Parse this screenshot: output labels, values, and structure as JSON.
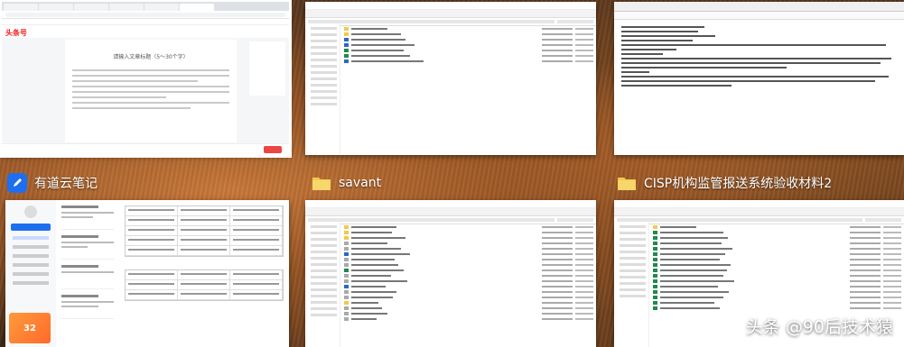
{
  "windows": [
    {
      "id": "browser",
      "brand": "头条号",
      "editor_title": "请输入文章标题（5～30个字）"
    },
    {
      "id": "explorer-top"
    },
    {
      "id": "notepad-top"
    },
    {
      "id": "youdao",
      "label": "有道云笔记",
      "icon": "youdao-icon",
      "promo": "32"
    },
    {
      "id": "savant",
      "label": "savant",
      "icon": "folder-icon"
    },
    {
      "id": "cisp",
      "label": "CISP机构监管报送系统验收材料2",
      "icon": "folder-icon"
    }
  ],
  "watermark": "头条 @90后技术猿",
  "colors": {
    "youdao": "#1e6ff0",
    "folder": "#f2c94c",
    "selection": "#ffffff"
  }
}
